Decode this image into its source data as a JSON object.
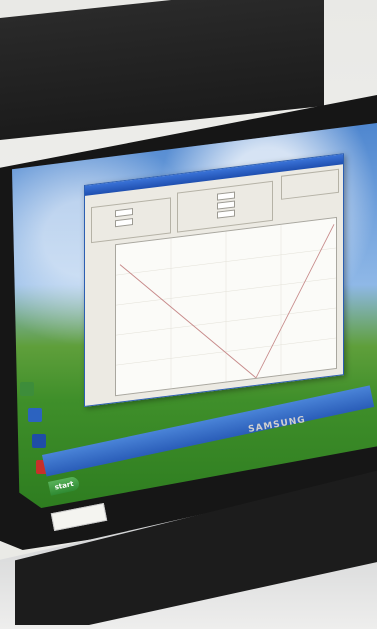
{
  "photo": {
    "laptop_brand": "SAMSUNG",
    "taskbar": {
      "start_label": "start"
    },
    "app_window": {
      "title": "",
      "menu": [
        "",
        "",
        ""
      ],
      "panel_labels": [
        "",
        ""
      ],
      "chart_present": true
    }
  },
  "colors": {
    "sky": "#4e86cf",
    "grass": "#3f8f2a",
    "window_title": "#1f4fb0",
    "bezel": "#161616"
  }
}
